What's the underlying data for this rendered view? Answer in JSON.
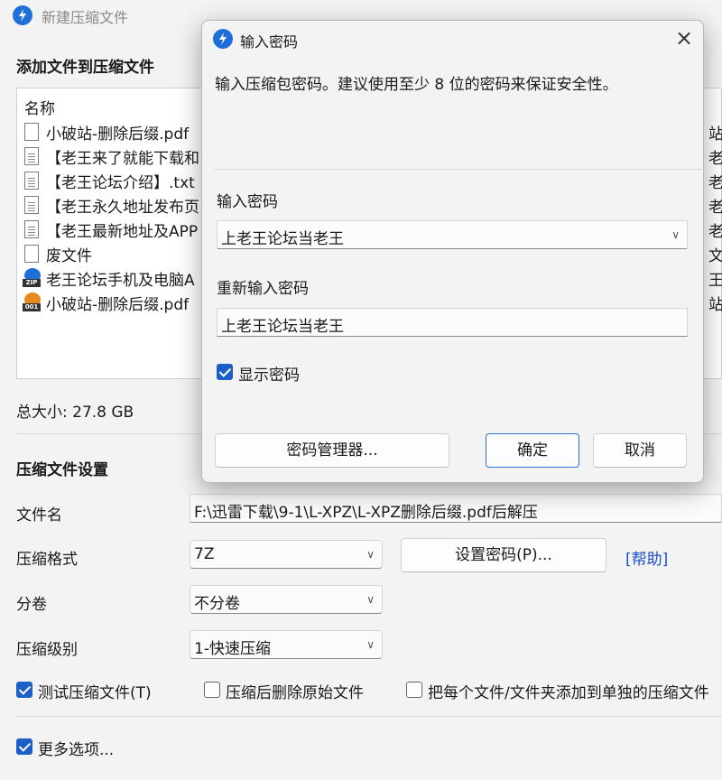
{
  "main": {
    "title": "新建压缩文件",
    "add_section_title": "添加文件到压缩文件",
    "list_header": "名称",
    "files": [
      {
        "name": "小破站-删除后缀.pdf",
        "tail": "站",
        "icon": "file-icon"
      },
      {
        "name": "【老王来了就能下载和",
        "tail": "老王",
        "icon": "text-file-icon"
      },
      {
        "name": "【老王论坛介绍】.txt",
        "tail": "老王",
        "icon": "text-file-icon"
      },
      {
        "name": "【老王永久地址发布页",
        "tail": "老王",
        "icon": "text-file-icon"
      },
      {
        "name": "【老王最新地址及APP",
        "tail": "老王",
        "icon": "text-file-icon"
      },
      {
        "name": "废文件",
        "tail": "文件",
        "icon": "file-icon"
      },
      {
        "name": "老王论坛手机及电脑A",
        "tail": "王论",
        "icon": "zip-archive-icon",
        "badge": "ZIP",
        "color": "#1e6fd9"
      },
      {
        "name": "小破站-删除后缀.pdf",
        "tail": "站",
        "icon": "split-archive-icon",
        "badge": "001",
        "color": "#e8891a"
      }
    ],
    "total_size": "总大小: 27.8 GB",
    "settings_title": "压缩文件设置",
    "filename_label": "文件名",
    "filename_value": "F:\\迅雷下载\\9-1\\L-XPZ\\L-XPZ删除后缀.pdf后解压",
    "format_label": "压缩格式",
    "format_value": "7Z",
    "set_password_button": "设置密码(P)...",
    "help_link": "[帮助]",
    "split_label": "分卷",
    "split_value": "不分卷",
    "level_label": "压缩级别",
    "level_value": "1-快速压缩",
    "test_archive_checkbox": "测试压缩文件(T)",
    "delete_original_checkbox": "压缩后删除原始文件",
    "each_file_checkbox": "把每个文件/文件夹添加到单独的压缩文件",
    "more_options_checkbox": "更多选项...",
    "test_archive_checked": true,
    "delete_original_checked": false,
    "each_file_checked": false,
    "more_options_checked": true
  },
  "dialog": {
    "title": "输入密码",
    "info": "输入压缩包密码。建议使用至少 8 位的密码来保证安全性。",
    "password_label": "输入密码",
    "password_value": "上老王论坛当老王",
    "reenter_label": "重新输入密码",
    "reenter_value": "上老王论坛当老王",
    "show_password_label": "显示密码",
    "show_password_checked": true,
    "password_manager_button": "密码管理器...",
    "ok_button": "确定",
    "cancel_button": "取消"
  },
  "colors": {
    "accent": "#1b5fc6",
    "app_icon": "#1e6fd9",
    "link": "#1a4fd0"
  }
}
